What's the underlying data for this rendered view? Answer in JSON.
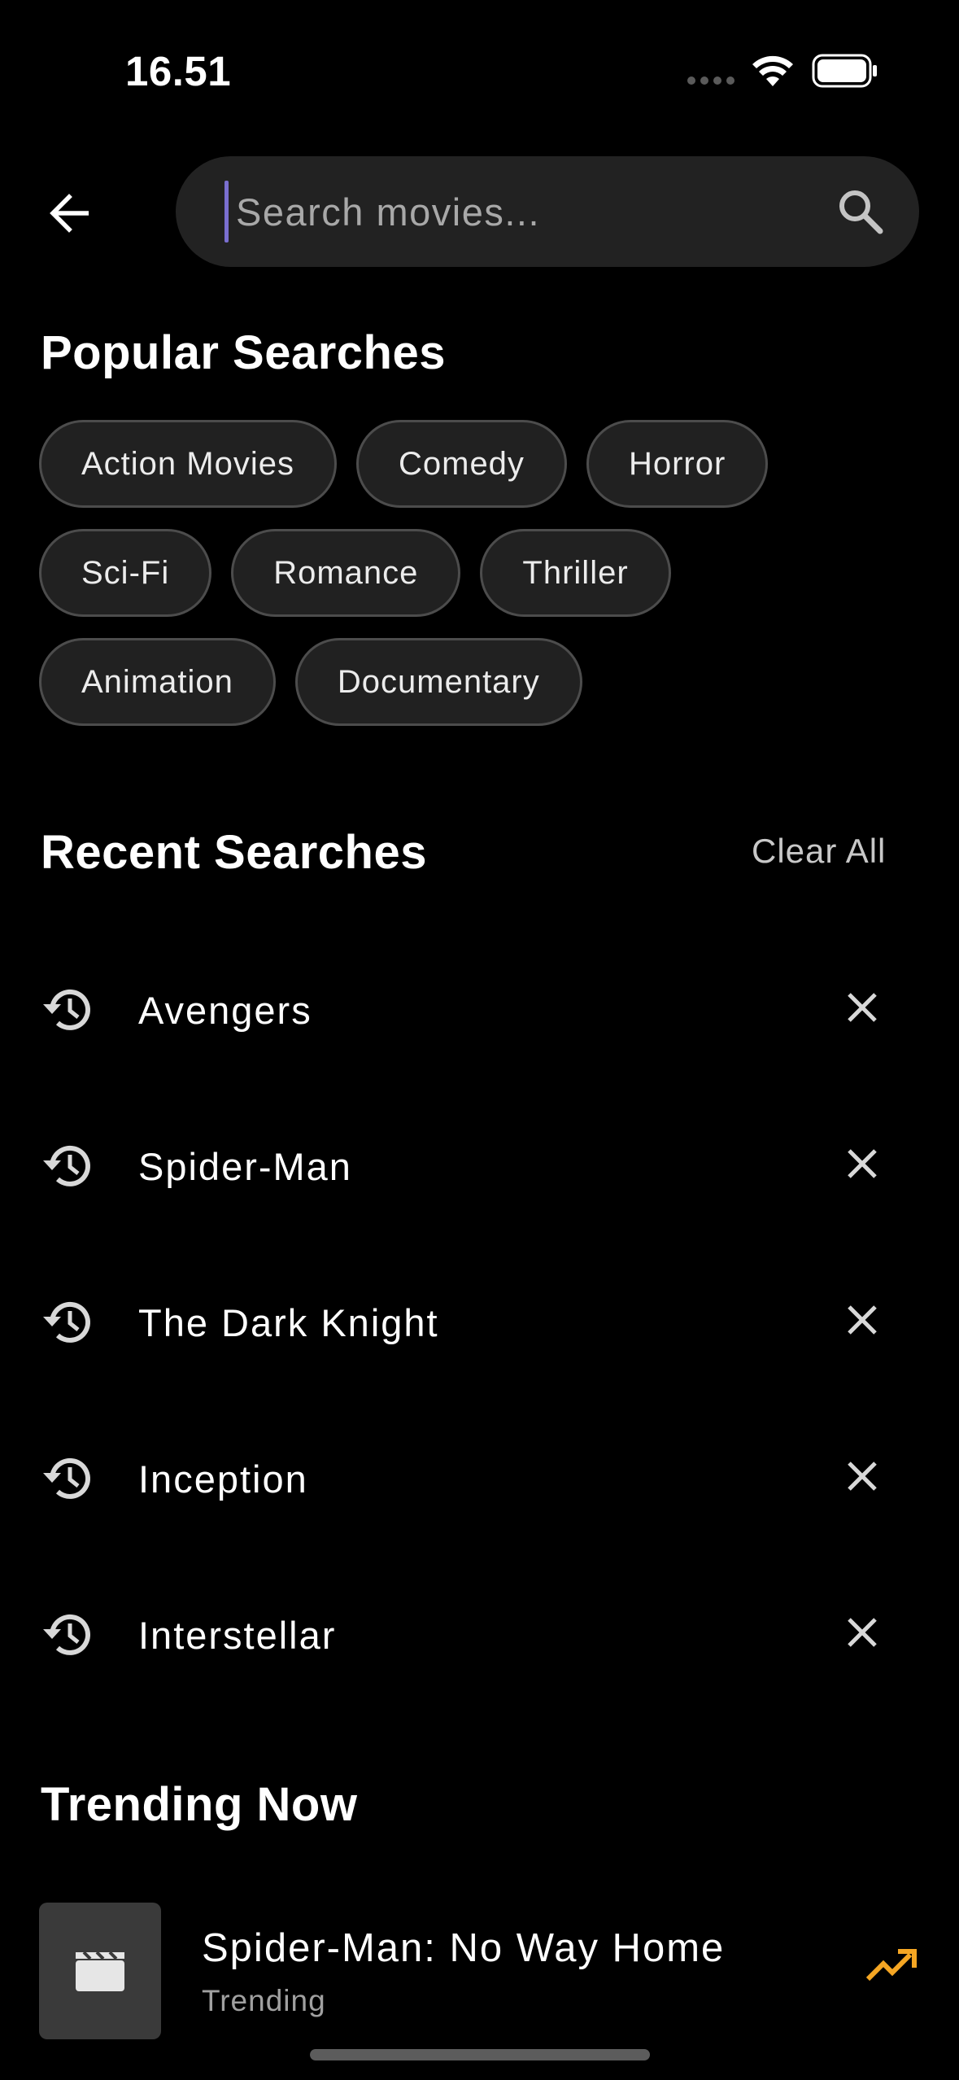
{
  "status_bar": {
    "time": "16.51",
    "icons": [
      "signal-dots-icon",
      "wifi-icon",
      "battery-icon"
    ]
  },
  "search": {
    "placeholder": "Search movies...",
    "value": "",
    "caret_color": "#7a6fd0"
  },
  "popular": {
    "title": "Popular Searches",
    "chips": [
      "Action Movies",
      "Comedy",
      "Horror",
      "Sci-Fi",
      "Romance",
      "Thriller",
      "Animation",
      "Documentary"
    ]
  },
  "recent": {
    "title": "Recent Searches",
    "clear_label": "Clear All",
    "items": [
      "Avengers",
      "Spider-Man",
      "The Dark Knight",
      "Inception",
      "Interstellar"
    ]
  },
  "trending": {
    "title": "Trending Now",
    "items": [
      {
        "title": "Spider-Man: No Way Home",
        "subtitle": "Trending",
        "icon": "trending-up-icon"
      }
    ]
  },
  "colors": {
    "background": "#000000",
    "chip_background": "#212121",
    "search_background": "#222222",
    "trending_accent": "#f5a623"
  }
}
